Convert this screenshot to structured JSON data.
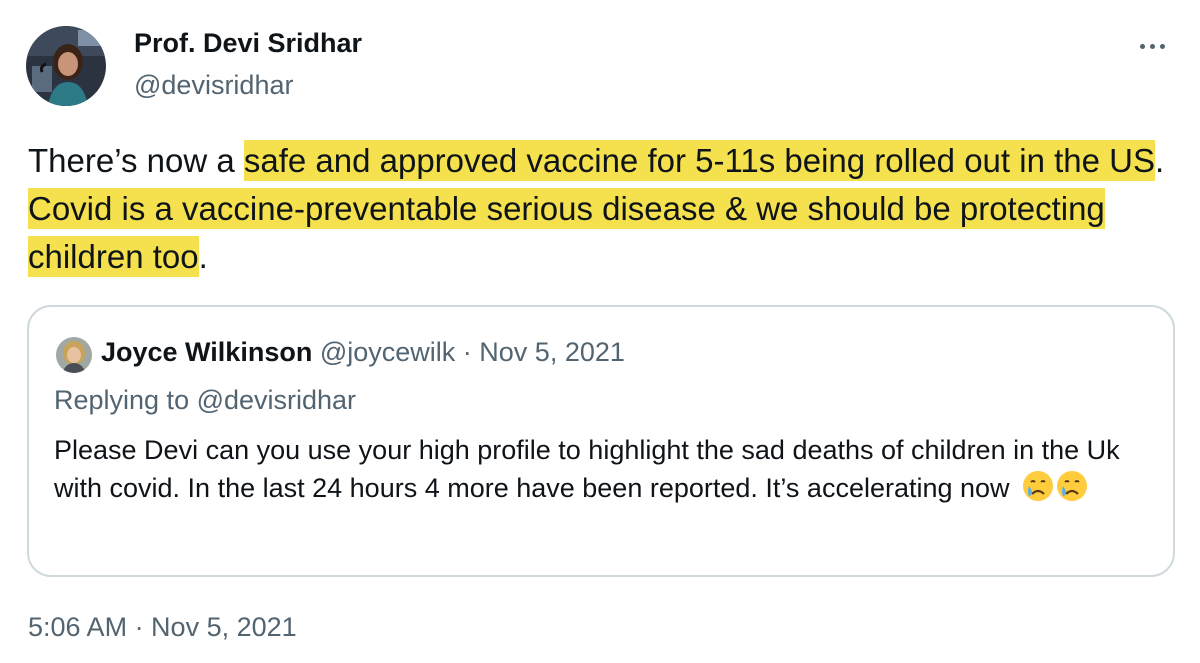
{
  "author": {
    "name": "Prof. Devi Sridhar",
    "handle": "@devisridhar"
  },
  "tweet": {
    "text_parts": [
      {
        "text": "There’s now a ",
        "highlight": false
      },
      {
        "text": "safe and approved vaccine for 5-11s being rolled out in the US",
        "highlight": true
      },
      {
        "text": ". ",
        "highlight": false
      },
      {
        "text": "Covid is a vaccine-preventable serious disease & we should be protecting children too",
        "highlight": true
      },
      {
        "text": ".",
        "highlight": false
      }
    ],
    "highlight_color": "#f5e04e",
    "timestamp": "5:06 AM · Nov 5, 2021"
  },
  "quoted_tweet": {
    "name": "Joyce Wilkinson",
    "handle": "@joycewilk",
    "separator": " · ",
    "date": "Nov 5, 2021",
    "replying_to": "Replying to @devisridhar",
    "text": "Please Devi can you use your high profile to highlight the sad deaths of children in the Uk with covid. In the last 24 hours 4 more have been reported. It’s accelerating now",
    "emojis": [
      "crying-face-icon",
      "crying-face-icon"
    ]
  },
  "icons": {
    "more": "more-horizontal-icon"
  },
  "colors": {
    "text_primary": "#0f1419",
    "text_secondary": "#536471",
    "border": "#cfd9de"
  }
}
